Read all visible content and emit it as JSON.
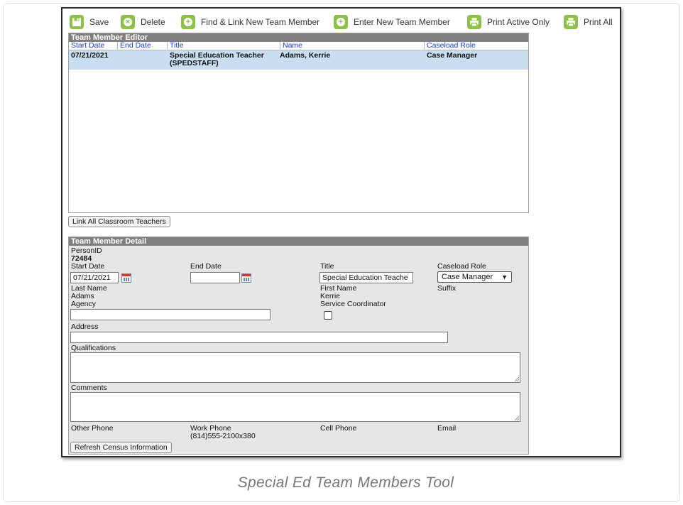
{
  "toolbar": {
    "save": "Save",
    "delete": "Delete",
    "find_link": "Find & Link New Team Member",
    "enter_new": "Enter New Team Member",
    "print_active": "Print Active Only",
    "print_all": "Print All"
  },
  "editor": {
    "title": "Team Member Editor",
    "columns": [
      "Start Date",
      "End Date",
      "Title",
      "Name",
      "Caseload Role"
    ],
    "rows": [
      {
        "start_date": "07/21/2021",
        "end_date": "",
        "title_line1": "Special Education Teacher",
        "title_line2": "(SPEDSTAFF)",
        "name": "Adams, Kerrie",
        "caseload_role": "Case Manager"
      }
    ]
  },
  "link_all_button": "Link All Classroom Teachers",
  "detail": {
    "title": "Team Member Detail",
    "person_id_label": "PersonID",
    "person_id": "72484",
    "start_date_label": "Start Date",
    "start_date_value": "07/21/2021",
    "end_date_label": "End Date",
    "end_date_value": "",
    "title_label": "Title",
    "title_value": "Special Education Teache",
    "caseload_role_label": "Caseload Role",
    "caseload_role_value": "Case Manager",
    "last_name_label": "Last Name",
    "last_name": "Adams",
    "first_name_label": "First Name",
    "first_name": "Kerrie",
    "suffix_label": "Suffix",
    "agency_label": "Agency",
    "agency_value": "",
    "service_coordinator_label": "Service Coordinator",
    "service_coordinator_checked": false,
    "address_label": "Address",
    "address_value": "",
    "qualifications_label": "Qualifications",
    "comments_label": "Comments",
    "other_phone_label": "Other Phone",
    "work_phone_label": "Work Phone",
    "work_phone": "(814)555-2100x380",
    "cell_phone_label": "Cell Phone",
    "email_label": "Email",
    "refresh_button": "Refresh Census Information"
  },
  "caption": "Special Ed Team Members Tool",
  "colors": {
    "toolbar_icon": "#8cc04a",
    "panel_header": "#7f7f7f",
    "selected_row": "#c9dff1",
    "column_header_text": "#1a3ccc",
    "detail_bg": "#e6e6e6"
  }
}
